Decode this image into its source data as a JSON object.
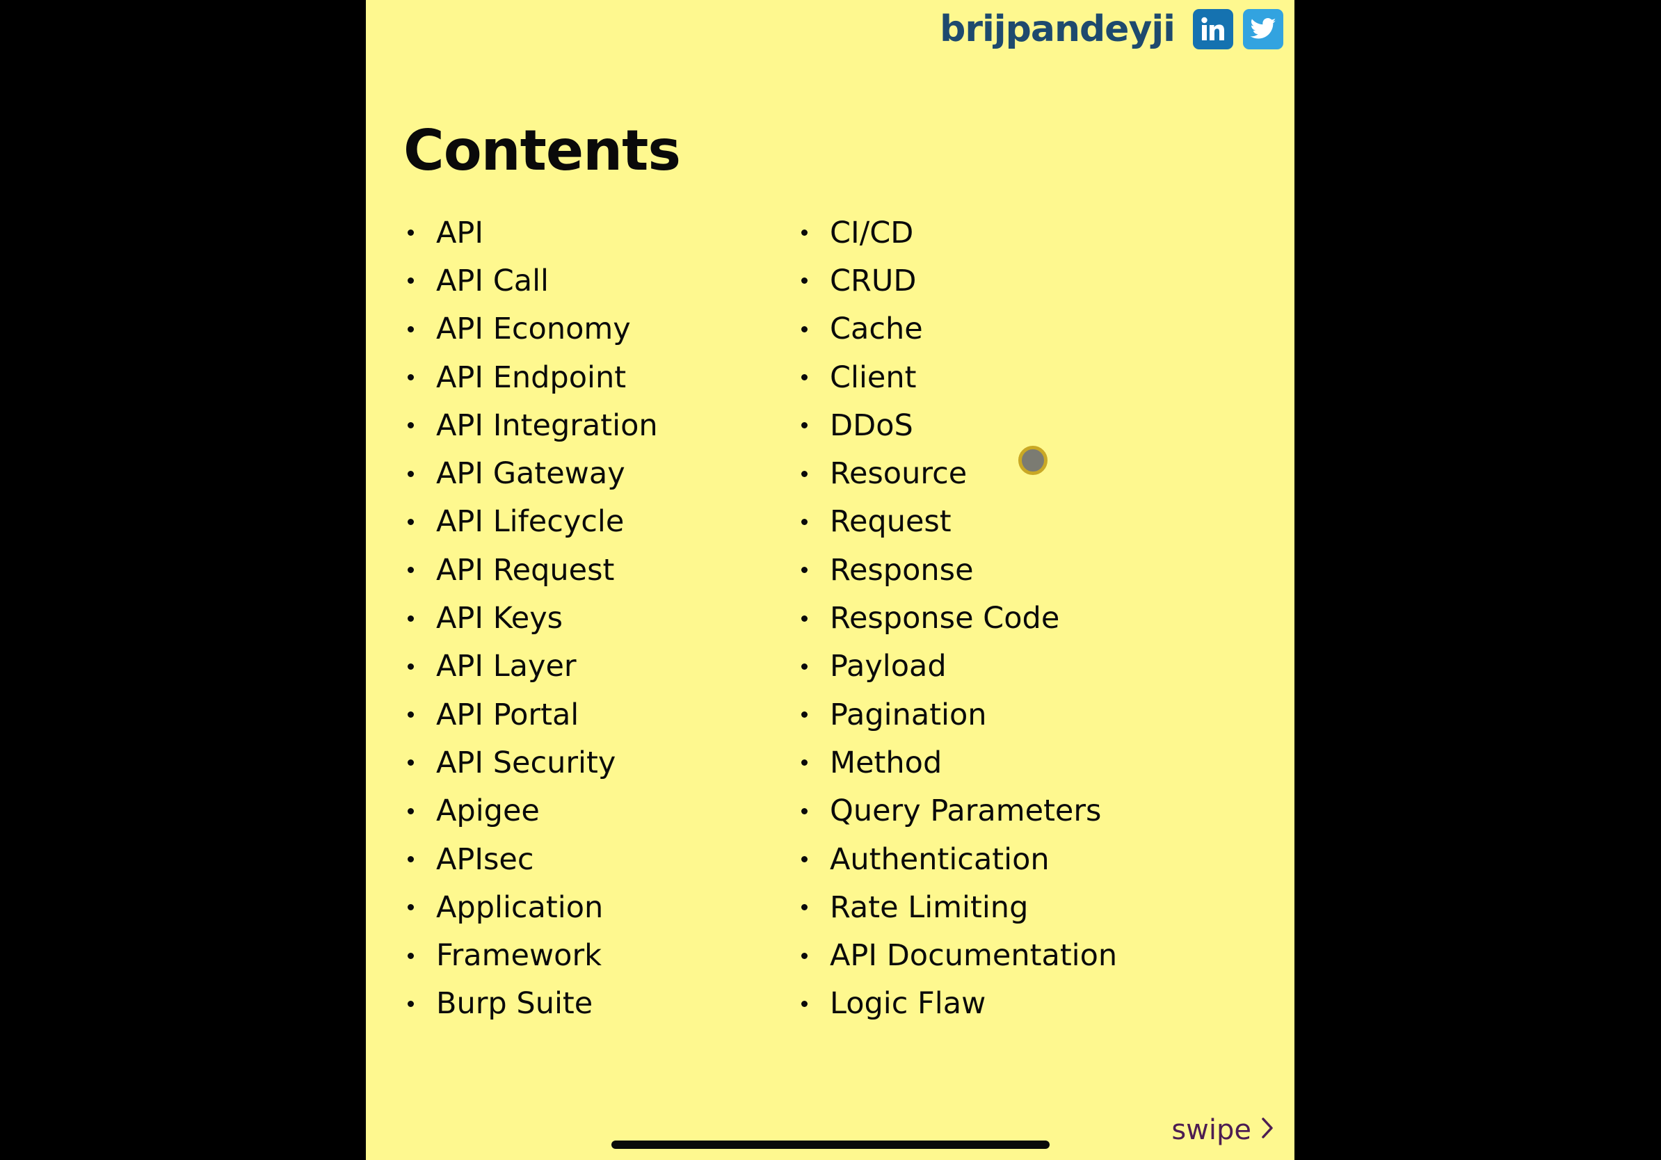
{
  "header": {
    "brand": "brijpandeyji",
    "icons": [
      "linkedin-icon",
      "twitter-icon"
    ],
    "brand_color": "#1e4a6e"
  },
  "title": "Contents",
  "left_items": [
    "API",
    "API Call",
    "API Economy",
    "API Endpoint",
    "API Integration",
    "API Gateway",
    "API Lifecycle",
    "API Request",
    "API Keys",
    "API Layer",
    "API Portal",
    "API Security",
    "Apigee",
    "APIsec",
    "Application",
    "Framework",
    "Burp Suite"
  ],
  "right_items": [
    "CI/CD",
    "CRUD",
    "Cache",
    "Client",
    "DDoS",
    "Resource",
    "Request",
    "Response",
    "Response Code",
    "Payload",
    "Pagination",
    "Method",
    "Query Parameters",
    "Authentication",
    "Rate Limiting",
    "API Documentation",
    "Logic Flaw"
  ],
  "footer": {
    "swipe_label": "swipe",
    "swipe_icon": "chevron-right-icon"
  },
  "colors": {
    "page_background": "#fef88f",
    "linkedin": "#1572b0",
    "twitter": "#32a3e0",
    "swipe_text": "#4d1e52"
  }
}
